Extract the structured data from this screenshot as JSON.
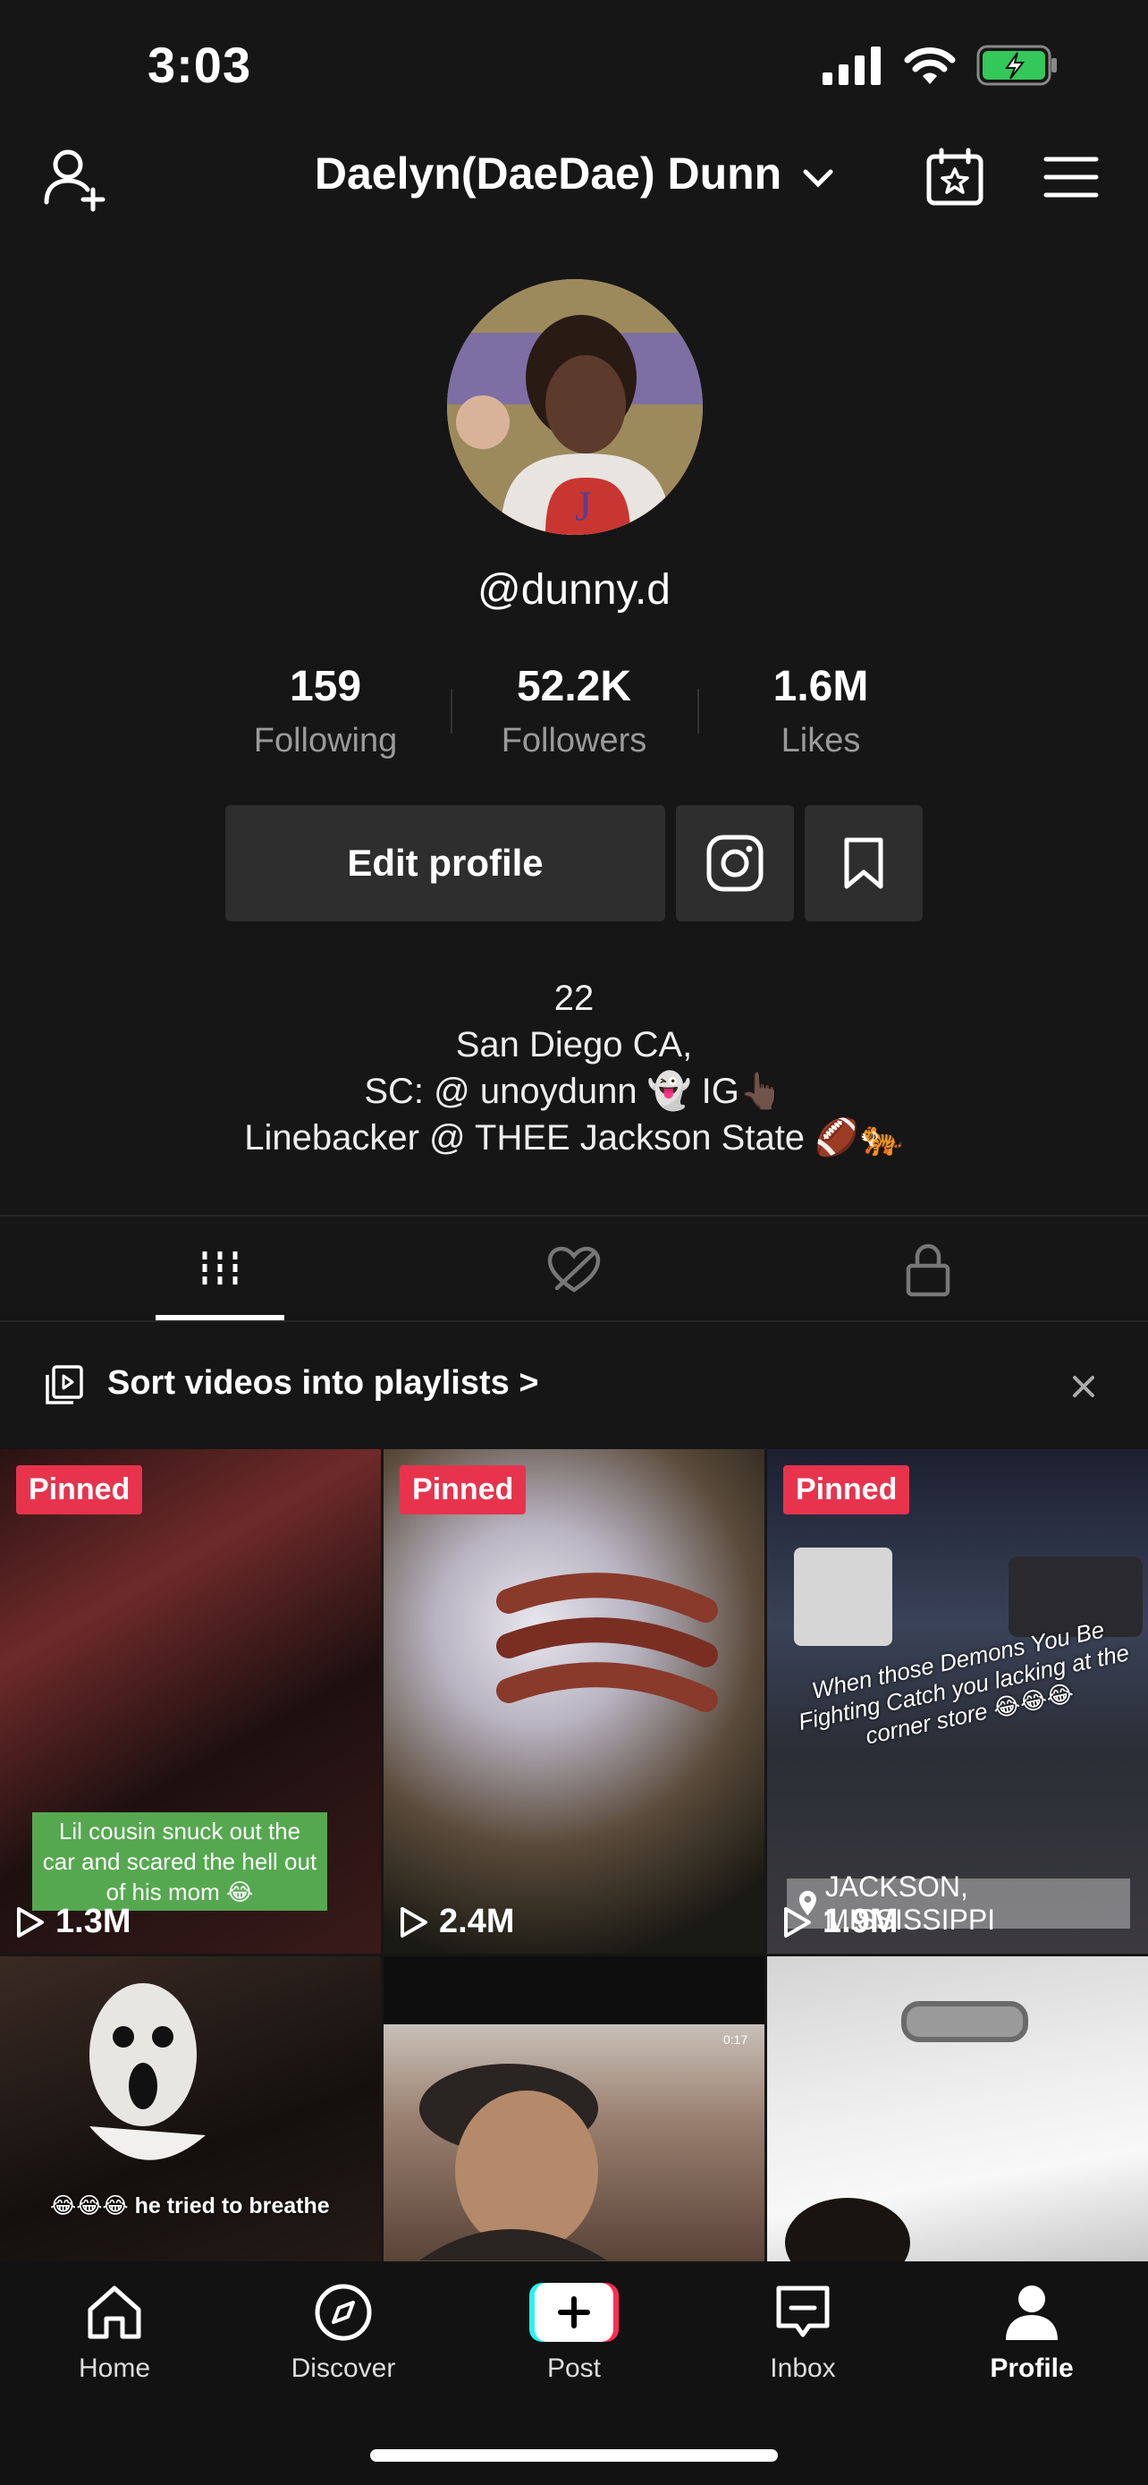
{
  "status": {
    "time": "3:03"
  },
  "header": {
    "title": "Daelyn(DaeDae) Dunn"
  },
  "profile": {
    "handle": "@dunny.d",
    "stats": [
      {
        "value": "159",
        "label": "Following"
      },
      {
        "value": "52.2K",
        "label": "Followers"
      },
      {
        "value": "1.6M",
        "label": "Likes"
      }
    ],
    "edit_label": "Edit profile",
    "bio": [
      "22",
      "San Diego CA,",
      "SC: @ unoydunn 👻 IG👆🏿",
      "Linebacker @ THEE Jackson State 🏈🐅"
    ]
  },
  "playlist_bar": {
    "label": "Sort videos into playlists >"
  },
  "videos": [
    {
      "pinned": "Pinned",
      "views": "1.3M",
      "caption": "Lil cousin snuck out the car and scared the hell out of his mom 😂"
    },
    {
      "pinned": "Pinned",
      "views": "2.4M"
    },
    {
      "pinned": "Pinned",
      "views": "1.9M",
      "caption": "When those Demons You Be Fighting Catch you lacking at the corner store 😂😂😂",
      "location": "JACKSON, MISSISSIPPI"
    },
    {
      "caption": "😂😂😂 he tried to breathe"
    },
    {
      "timestamp": "0:17"
    },
    {}
  ],
  "nav": [
    {
      "label": "Home",
      "icon": "home-icon"
    },
    {
      "label": "Discover",
      "icon": "compass-icon"
    },
    {
      "label": "Post",
      "icon": "plus-icon"
    },
    {
      "label": "Inbox",
      "icon": "inbox-icon"
    },
    {
      "label": "Profile",
      "icon": "person-icon"
    }
  ],
  "colors": {
    "pinned": "#e8334d",
    "background": "#161616"
  }
}
